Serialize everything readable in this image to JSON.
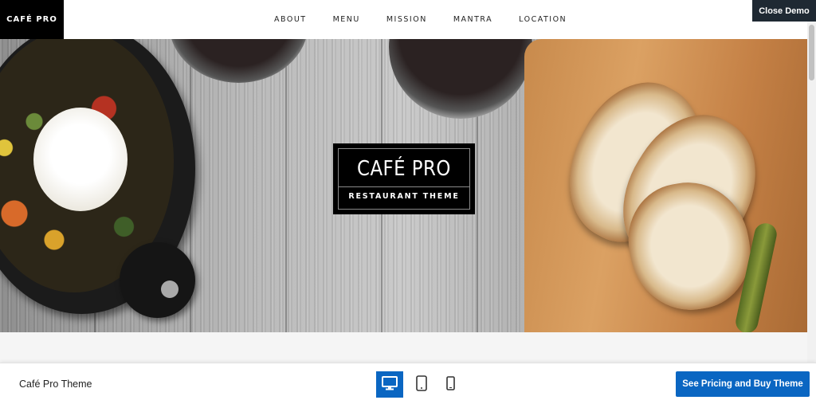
{
  "header": {
    "logo": "CAFÉ PRO",
    "nav": [
      {
        "label": "ABOUT"
      },
      {
        "label": "MENU"
      },
      {
        "label": "MISSION"
      },
      {
        "label": "MANTRA"
      },
      {
        "label": "LOCATION"
      }
    ],
    "close_demo": "Close Demo"
  },
  "hero": {
    "title": "CAFÉ PRO",
    "subtitle": "RESTAURANT THEME"
  },
  "demo_bar": {
    "theme_name": "Café Pro Theme",
    "devices": [
      {
        "icon": "desktop-icon",
        "active": true
      },
      {
        "icon": "tablet-icon",
        "active": false
      },
      {
        "icon": "mobile-icon",
        "active": false
      }
    ],
    "buy_label": "See Pricing and Buy Theme"
  },
  "colors": {
    "accent": "#0a66c2",
    "close_demo_bg": "#1f2933",
    "logo_bg": "#000000"
  }
}
